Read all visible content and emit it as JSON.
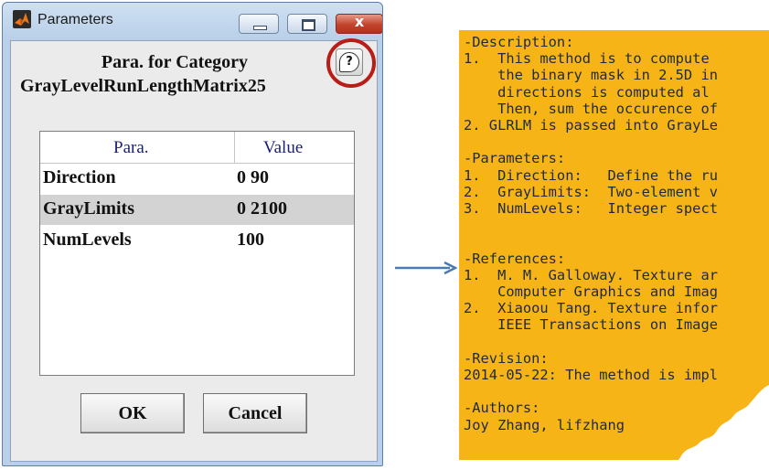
{
  "window": {
    "title": "Parameters",
    "icon": "matlab-icon",
    "controls": [
      "minimize-icon",
      "maximize-icon",
      "close-icon"
    ],
    "close_glyph": "x"
  },
  "dialog": {
    "heading_line1": "Para. for Category",
    "heading_line2": "GrayLevelRunLengthMatrix25",
    "help_glyph": "?",
    "table": {
      "columns": [
        "Para.",
        "Value"
      ],
      "rows": [
        {
          "name": "Direction",
          "value": "0  90"
        },
        {
          "name": "GrayLimits",
          "value": "0  2100"
        },
        {
          "name": "NumLevels",
          "value": "100"
        }
      ],
      "selected_row": 1
    },
    "buttons": {
      "ok": "OK",
      "cancel": "Cancel"
    }
  },
  "help_note": {
    "lines": [
      "-Description:",
      "1.  This method is to compute",
      "    the binary mask in 2.5D in",
      "    directions is computed al",
      "    Then, sum the occurence of",
      "2. GLRLM is passed into GrayLe",
      "",
      "-Parameters:",
      "1.  Direction:   Define the ru",
      "2.  GrayLimits:  Two-element v",
      "3.  NumLevels:   Integer spect",
      "",
      "",
      "-References:",
      "1.  M. M. Galloway. Texture ar",
      "    Computer Graphics and Imag",
      "2.  Xiaoou Tang. Texture infor",
      "    IEEE Transactions on Image",
      "",
      "-Revision:",
      "2014-05-22: The method is impl",
      "",
      "-Authors:",
      "Joy Zhang, lifzhang"
    ]
  },
  "colors": {
    "note_background": "#f7b417",
    "highlight_ring": "#b81d17",
    "arrow": "#4a7ab0",
    "header_text": "#1b1f73"
  }
}
